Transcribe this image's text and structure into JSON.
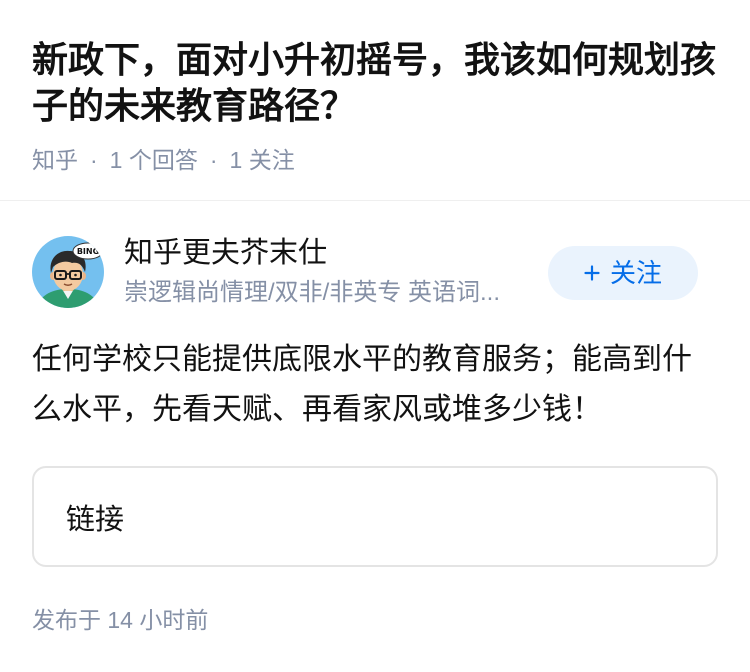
{
  "question": {
    "title": "新政下，面对小升初摇号，我该如何规划孩子的未来教育路径？"
  },
  "meta": {
    "source": "知乎",
    "separator": "·",
    "answer_count": "1 个回答",
    "follow_count": "1 关注"
  },
  "author": {
    "name": "知乎更夫芥末仕",
    "headline": "崇逻辑尚情理/双非/非英专 英语词...",
    "avatar_text": "BING"
  },
  "follow_button": {
    "label": "关注",
    "icon": "plus-icon"
  },
  "answer": {
    "content": "任何学校只能提供底限水平的教育服务；能高到什么水平，先看天赋、再看家风或堆多少钱！",
    "link_card_label": "链接",
    "published": "发布于 14 小时前"
  },
  "colors": {
    "primary_text": "#121212",
    "secondary_text": "#8590a6",
    "accent": "#056de8",
    "follow_bg": "#eaf3fd",
    "border": "#e4e4e4"
  }
}
